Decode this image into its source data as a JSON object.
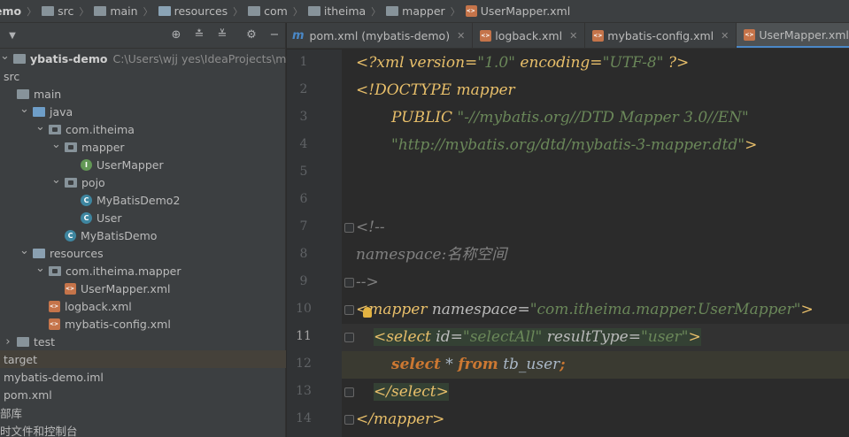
{
  "breadcrumb": [
    {
      "label": "emo",
      "kind": "project"
    },
    {
      "label": "src",
      "kind": "folder"
    },
    {
      "label": "main",
      "kind": "folder"
    },
    {
      "label": "resources",
      "kind": "folder"
    },
    {
      "label": "com",
      "kind": "folder"
    },
    {
      "label": "itheima",
      "kind": "folder"
    },
    {
      "label": "mapper",
      "kind": "folder"
    },
    {
      "label": "UserMapper.xml",
      "kind": "xml-file"
    }
  ],
  "project_toolbar": {
    "icons": [
      "locate-icon",
      "expand-all-icon",
      "collapse-all-icon",
      "settings-gear-icon",
      "hide-icon"
    ]
  },
  "tree": [
    {
      "label": "ybatis-demo",
      "path": "C:\\Users\\wjj   yes\\IdeaProjects\\mybatis\\my",
      "icon": "module",
      "depth": 0,
      "arrow": "down"
    },
    {
      "label": "src",
      "icon": "none",
      "depth": 0
    },
    {
      "label": "main",
      "icon": "folder",
      "depth": 0
    },
    {
      "label": "java",
      "icon": "source-folder",
      "depth": 1,
      "arrow": "down"
    },
    {
      "label": "com.itheima",
      "icon": "package",
      "depth": 2,
      "arrow": "down"
    },
    {
      "label": "mapper",
      "icon": "package",
      "depth": 3,
      "arrow": "down"
    },
    {
      "label": "UserMapper",
      "icon": "interface",
      "depth": 4
    },
    {
      "label": "pojo",
      "icon": "package",
      "depth": 3,
      "arrow": "down"
    },
    {
      "label": "MyBatisDemo2",
      "icon": "class",
      "depth": 4
    },
    {
      "label": "User",
      "icon": "class",
      "depth": 4
    },
    {
      "label": "MyBatisDemo",
      "icon": "class",
      "depth": 3
    },
    {
      "label": "resources",
      "icon": "resource-folder",
      "depth": 1,
      "arrow": "down"
    },
    {
      "label": "com.itheima.mapper",
      "icon": "package",
      "depth": 2,
      "arrow": "down"
    },
    {
      "label": "UserMapper.xml",
      "icon": "xml",
      "depth": 3
    },
    {
      "label": "logback.xml",
      "icon": "xml",
      "depth": 2
    },
    {
      "label": "mybatis-config.xml",
      "icon": "xml",
      "depth": 2
    },
    {
      "label": "test",
      "icon": "folder",
      "depth": 0,
      "arrow": "right"
    },
    {
      "label": "target",
      "icon": "none",
      "depth": 0,
      "selected": true
    },
    {
      "label": "mybatis-demo.iml",
      "icon": "none",
      "depth": 0
    },
    {
      "label": "pom.xml",
      "icon": "none",
      "depth": 0
    },
    {
      "label": "部库",
      "icon": "none",
      "depth": 0
    },
    {
      "label": "时文件和控制台",
      "icon": "none",
      "depth": 0
    }
  ],
  "tabs": [
    {
      "label": "pom.xml (mybatis-demo)",
      "icon": "maven-icon",
      "active": false
    },
    {
      "label": "logback.xml",
      "icon": "xml-file-icon",
      "active": false
    },
    {
      "label": "mybatis-config.xml",
      "icon": "xml-file-icon",
      "active": false
    },
    {
      "label": "UserMapper.xml",
      "icon": "xml-file-icon",
      "active": true
    }
  ],
  "editor": {
    "current_line": 11,
    "lines": [
      {
        "n": "1"
      },
      {
        "n": "2"
      },
      {
        "n": "3"
      },
      {
        "n": "4"
      },
      {
        "n": "5"
      },
      {
        "n": "6"
      },
      {
        "n": "7"
      },
      {
        "n": "8"
      },
      {
        "n": "9"
      },
      {
        "n": "10"
      },
      {
        "n": "11"
      },
      {
        "n": "12"
      },
      {
        "n": "13"
      },
      {
        "n": "14"
      }
    ],
    "code": {
      "l1_a": "<?xml version=",
      "l1_b": "\"1.0\"",
      "l1_c": " encoding=",
      "l1_d": "\"UTF-8\"",
      "l1_e": " ?>",
      "l2_a": "<!DOCTYPE mapper",
      "l3_a": "PUBLIC ",
      "l3_b": "\"-//mybatis.org//DTD Mapper 3.0//EN\"",
      "l4_a": "\"http://mybatis.org/dtd/mybatis-3-mapper.dtd\"",
      "l4_b": ">",
      "l7_a": "<!--",
      "l8_a": "namespace:名称空间",
      "l9_a": "-->",
      "l10_a": "<mapper ",
      "l10_b": "namespace=",
      "l10_c": "\"com.itheima.mapper.UserMapper\"",
      "l10_d": ">",
      "l11_a": "<select ",
      "l11_b": "id=",
      "l11_c": "\"selectAll\"",
      "l11_d": " resultType=",
      "l11_e": "\"user\"",
      "l11_f": ">",
      "l12_a": "select",
      "l12_b": " * ",
      "l12_c": "from",
      "l12_d": " tb_user",
      "l12_e": ";",
      "l13_a": "</select>",
      "l14_a": "</mapper>"
    }
  },
  "colors": {
    "tag": "#e8bf6a",
    "string": "#6a8759",
    "keyword": "#cc7832",
    "comment": "#808080",
    "accent": "#4a88c7"
  }
}
